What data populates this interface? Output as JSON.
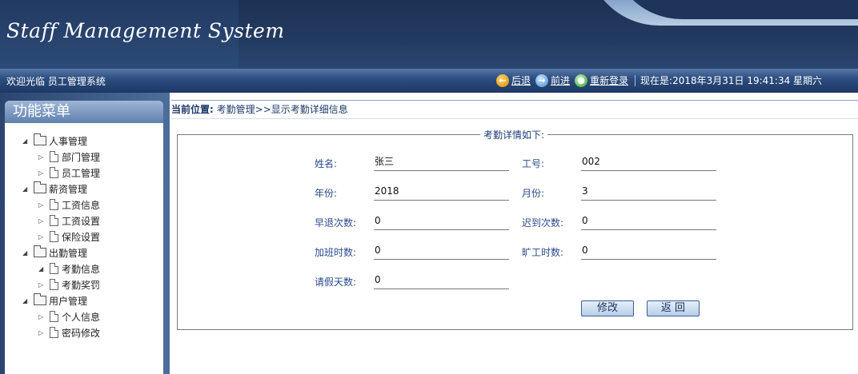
{
  "header": {
    "title": "Staff Management System"
  },
  "statusbar": {
    "welcome": "欢迎光临 员工管理系统",
    "back_label": "后退",
    "forward_label": "前进",
    "relogin_label": "重新登录",
    "datetime": "现在是:2018年3月31日 19:41:34 星期六"
  },
  "menu": {
    "title": "功能菜单",
    "groups": [
      {
        "label": "人事管理",
        "items": [
          {
            "label": "部门管理"
          },
          {
            "label": "员工管理"
          }
        ]
      },
      {
        "label": "薪资管理",
        "items": [
          {
            "label": "工资信息"
          },
          {
            "label": "工资设置"
          },
          {
            "label": "保险设置"
          }
        ]
      },
      {
        "label": "出勤管理",
        "items": [
          {
            "label": "考勤信息"
          },
          {
            "label": "考勤奖罚"
          }
        ]
      },
      {
        "label": "用户管理",
        "items": [
          {
            "label": "个人信息"
          },
          {
            "label": "密码修改"
          }
        ]
      }
    ]
  },
  "breadcrumb": {
    "label": "当前位置:",
    "path": "考勤管理>>显示考勤详细信息"
  },
  "details": {
    "legend": "考勤详情如下:",
    "fields": {
      "name": {
        "label": "姓名:",
        "value": "张三"
      },
      "staff_no": {
        "label": "工号:",
        "value": "002"
      },
      "year": {
        "label": "年份:",
        "value": "2018"
      },
      "month": {
        "label": "月份:",
        "value": "3"
      },
      "early_leave": {
        "label": "早退次数:",
        "value": "0"
      },
      "late": {
        "label": "迟到次数:",
        "value": "0"
      },
      "overtime": {
        "label": "加班时数:",
        "value": "0"
      },
      "absent": {
        "label": "旷工时数:",
        "value": "0"
      },
      "leave_days": {
        "label": "请假天数:",
        "value": "0"
      }
    },
    "edit_label": "修改",
    "back_label": "返 回"
  }
}
